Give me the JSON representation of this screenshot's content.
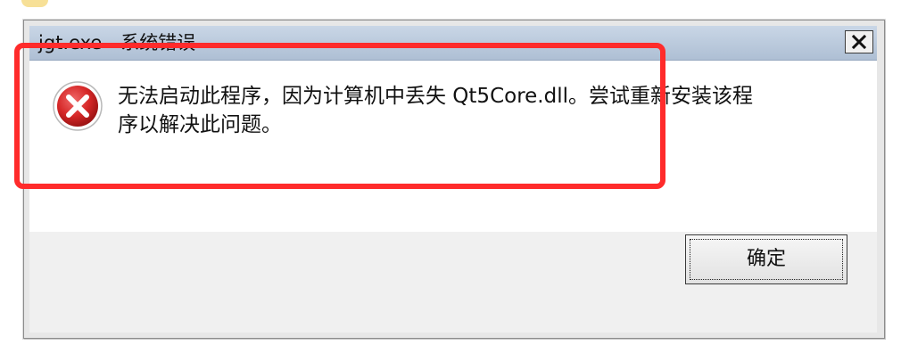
{
  "window": {
    "title": "jgt.exe - 系统错误",
    "close_icon": "close-icon"
  },
  "message": {
    "icon": "error-icon",
    "line1": "无法启动此程序，因为计算机中丢失 Qt5Core.dll。尝试重新安装该程",
    "line2": "序以解决此问题。"
  },
  "buttons": {
    "ok_label": "确定"
  },
  "colors": {
    "highlight": "#ff2b2b",
    "error_icon": "#d62828",
    "titlebar": "#b7c7db"
  }
}
